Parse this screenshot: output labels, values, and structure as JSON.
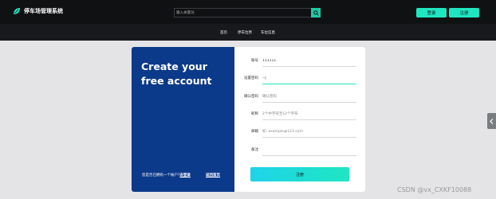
{
  "header": {
    "logo_text": "停车场管理系统",
    "search_placeholder": "输入关键词",
    "login_label": "登录",
    "register_label": "注册"
  },
  "nav": {
    "items": [
      "首页",
      "停车位势",
      "车位信息"
    ]
  },
  "card": {
    "headline": "Create your free account",
    "already_text": "您是否已拥有一个帐户?",
    "login_link": "去登录",
    "back_link": "返回首页"
  },
  "form": {
    "fields": [
      {
        "label": "账号",
        "value": "111111",
        "placeholder": ""
      },
      {
        "label": "设置密码",
        "value": "--|",
        "placeholder": ""
      },
      {
        "label": "确认密码",
        "value": "",
        "placeholder": "确认密码"
      },
      {
        "label": "昵称",
        "value": "",
        "placeholder": "2个中字符至12个字符"
      },
      {
        "label": "邮箱",
        "value": "",
        "placeholder": "如: example@123.com"
      },
      {
        "label": "备注",
        "value": "",
        "placeholder": ""
      }
    ],
    "submit_label": "注册"
  },
  "watermark": "CSDN @vx_CXKF10088",
  "colors": {
    "topbar_bg": "#0f1113",
    "accent": "#1fe6c1",
    "card_left_bg": "#0c3a8a",
    "page_bg": "#e4e4e6"
  },
  "icons": {
    "logo": "leaf-icon",
    "search": "search-icon",
    "side": "chevron-left-icon"
  }
}
